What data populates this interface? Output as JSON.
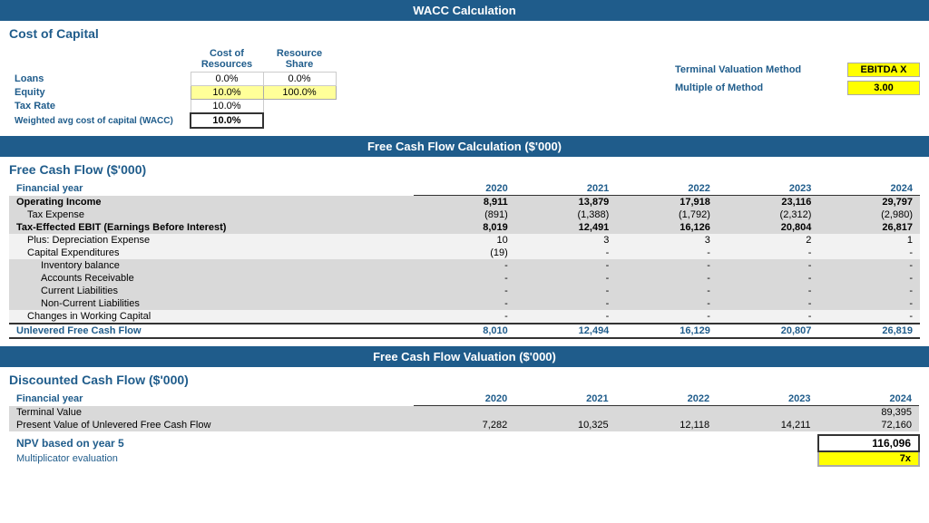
{
  "page": {
    "title": "WACC Calculation",
    "sections": {
      "wacc": {
        "title": "WACC Calculation",
        "subsection_title": "Cost of Capital",
        "col_headers": [
          "Cost of Resources",
          "Resource Share"
        ],
        "rows": [
          {
            "label": "Loans",
            "cost": "0.0%",
            "share": "0.0%"
          },
          {
            "label": "Equity",
            "cost": "10.0%",
            "share": "100.0%"
          },
          {
            "label": "Tax Rate",
            "cost": "10.0%",
            "share": ""
          },
          {
            "label": "Weighted avg cost of capital (WACC)",
            "cost": "10.0%",
            "share": ""
          }
        ],
        "terminal_label": "Terminal Valuation Method",
        "terminal_value": "EBITDA X",
        "multiple_label": "Multiple of Method",
        "multiple_value": "3.00"
      },
      "fcf": {
        "title": "Free Cash Flow Calculation ($'000)",
        "subsection_title": "Free Cash Flow ($'000)",
        "col_headers": [
          "",
          "2020",
          "2021",
          "2022",
          "2023",
          "2024"
        ],
        "rows": [
          {
            "label": "Financial year",
            "v2020": "2020",
            "v2021": "2021",
            "v2022": "2022",
            "v2023": "2023",
            "v2024": "2024",
            "style": "header"
          },
          {
            "label": "Operating Income",
            "v2020": "8,911",
            "v2021": "13,879",
            "v2022": "17,918",
            "v2023": "23,116",
            "v2024": "29,797",
            "style": "bold-shaded"
          },
          {
            "label": "Tax Expense",
            "v2020": "(891)",
            "v2021": "(1,388)",
            "v2022": "(1,792)",
            "v2023": "(2,312)",
            "v2024": "(2,980)",
            "style": "indent1-shaded"
          },
          {
            "label": "Tax-Effected EBIT (Earnings Before Interest)",
            "v2020": "8,019",
            "v2021": "12,491",
            "v2022": "16,126",
            "v2023": "20,804",
            "v2024": "26,817",
            "style": "bold-shaded"
          },
          {
            "label": "Plus: Depreciation Expense",
            "v2020": "10",
            "v2021": "3",
            "v2022": "3",
            "v2023": "2",
            "v2024": "1",
            "style": "indent1-light"
          },
          {
            "label": "Capital Expenditures",
            "v2020": "(19)",
            "v2021": "-",
            "v2022": "-",
            "v2023": "-",
            "v2024": "-",
            "style": "indent1-light"
          },
          {
            "label": "Inventory balance",
            "v2020": "-",
            "v2021": "-",
            "v2022": "-",
            "v2023": "-",
            "v2024": "-",
            "style": "indent2-shaded"
          },
          {
            "label": "Accounts Receivable",
            "v2020": "-",
            "v2021": "-",
            "v2022": "-",
            "v2023": "-",
            "v2024": "-",
            "style": "indent2-shaded"
          },
          {
            "label": "Current Liabilities",
            "v2020": "-",
            "v2021": "-",
            "v2022": "-",
            "v2023": "-",
            "v2024": "-",
            "style": "indent2-shaded"
          },
          {
            "label": "Non-Current Liabilities",
            "v2020": "-",
            "v2021": "-",
            "v2022": "-",
            "v2023": "-",
            "v2024": "-",
            "style": "indent2-shaded"
          },
          {
            "label": "Changes in Working Capital",
            "v2020": "-",
            "v2021": "-",
            "v2022": "-",
            "v2023": "-",
            "v2024": "-",
            "style": "indent1-light"
          },
          {
            "label": "Unlevered Free Cash Flow",
            "v2020": "8,010",
            "v2021": "12,494",
            "v2022": "16,129",
            "v2023": "20,807",
            "v2024": "26,819",
            "style": "bold-blue-border"
          }
        ]
      },
      "dcf": {
        "title": "Free Cash Flow Valuation ($'000)",
        "subsection_title": "Discounted Cash Flow ($'000)",
        "rows": [
          {
            "label": "Financial year",
            "v2020": "2020",
            "v2021": "2021",
            "v2022": "2022",
            "v2023": "2023",
            "v2024": "2024",
            "style": "header"
          },
          {
            "label": "Terminal Value",
            "v2020": "",
            "v2021": "",
            "v2022": "",
            "v2023": "",
            "v2024": "89,395",
            "style": "shaded"
          },
          {
            "label": "Present Value of Unlevered Free Cash Flow",
            "v2020": "7,282",
            "v2021": "10,325",
            "v2022": "12,118",
            "v2023": "14,211",
            "v2024": "72,160",
            "style": "shaded"
          },
          {
            "label": "NPV based on year 5",
            "v2020": "",
            "v2021": "",
            "v2022": "",
            "v2023": "",
            "v2024": "116,096",
            "style": "npv-bold"
          },
          {
            "label": "Multiplicator evaluation",
            "v2020": "",
            "v2021": "",
            "v2022": "",
            "v2023": "",
            "v2024": "7x",
            "style": "mult"
          }
        ]
      }
    }
  }
}
